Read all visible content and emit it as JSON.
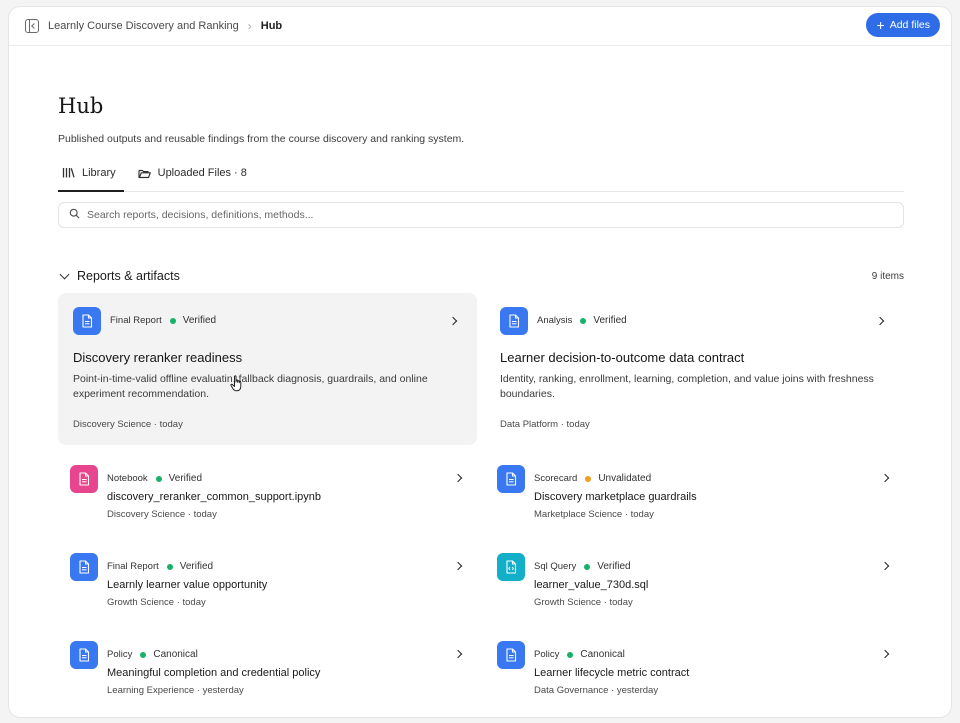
{
  "topbar": {
    "breadcrumb_root": "Learnly Course Discovery and Ranking",
    "breadcrumb_separator": "›",
    "breadcrumb_current": "Hub",
    "add_button_label": "Add files"
  },
  "page": {
    "title": "Hub",
    "subtitle": "Published outputs and reusable findings from the course discovery and ranking system."
  },
  "tabs": [
    {
      "label": "Library",
      "icon": "library-icon",
      "active": true
    },
    {
      "label": "Uploaded Files · 8",
      "icon": "folder-open-icon",
      "active": false
    }
  ],
  "search": {
    "placeholder": "Search reports, decisions, definitions, methods..."
  },
  "section": {
    "title": "Reports & artifacts",
    "count": "9 items"
  },
  "featured": [
    {
      "type": "Final Report",
      "status": "Verified",
      "status_color": "#17b26a",
      "title": "Discovery reranker readiness",
      "desc_a": "Point-in-time-valid offline evaluati",
      "desc_b": "n, fallback diagnosis, guardrails, and online",
      "desc_line2": "experiment recommendation.",
      "footer": "Discovery Science · today",
      "icon_color": "#3a78f2"
    },
    {
      "type": "Analysis",
      "status": "Verified",
      "status_color": "#17b26a",
      "title": "Learner decision-to-outcome data contract",
      "desc_line1": "Identity, ranking, enrollment, learning, completion, and value joins with freshness",
      "desc_line2": "boundaries.",
      "footer": "Data Platform · today",
      "icon_color": "#3a78f2"
    }
  ],
  "items": [
    {
      "type": "Notebook",
      "status": "Verified",
      "status_color": "#17b26a",
      "title": "discovery_reranker_common_support.ipynb",
      "footer": "Discovery Science · today",
      "icon": "notebook-icon",
      "icon_color": "#e8458f"
    },
    {
      "type": "Scorecard",
      "status": "Unvalidated",
      "status_color": "#f0a020",
      "title": "Discovery marketplace guardrails",
      "footer": "Marketplace Science · today",
      "icon": "document-icon",
      "icon_color": "#3a78f2"
    },
    {
      "type": "Final Report",
      "status": "Verified",
      "status_color": "#17b26a",
      "title": "Learnly learner value opportunity",
      "footer": "Growth Science · today",
      "icon": "document-icon",
      "icon_color": "#3a78f2"
    },
    {
      "type": "Sql Query",
      "status": "Verified",
      "status_color": "#17b26a",
      "title": "learner_value_730d.sql",
      "footer": "Growth Science · today",
      "icon": "sql-file-icon",
      "icon_color": "#13afc9"
    },
    {
      "type": "Policy",
      "status": "Canonical",
      "status_color": "#17b26a",
      "title": "Meaningful completion and credential policy",
      "footer": "Learning Experience · yesterday",
      "icon": "document-icon",
      "icon_color": "#3a78f2"
    },
    {
      "type": "Policy",
      "status": "Canonical",
      "status_color": "#17b26a",
      "title": "Learner lifecycle metric contract",
      "footer": "Data Governance · yesterday",
      "icon": "document-icon",
      "icon_color": "#3a78f2"
    }
  ]
}
